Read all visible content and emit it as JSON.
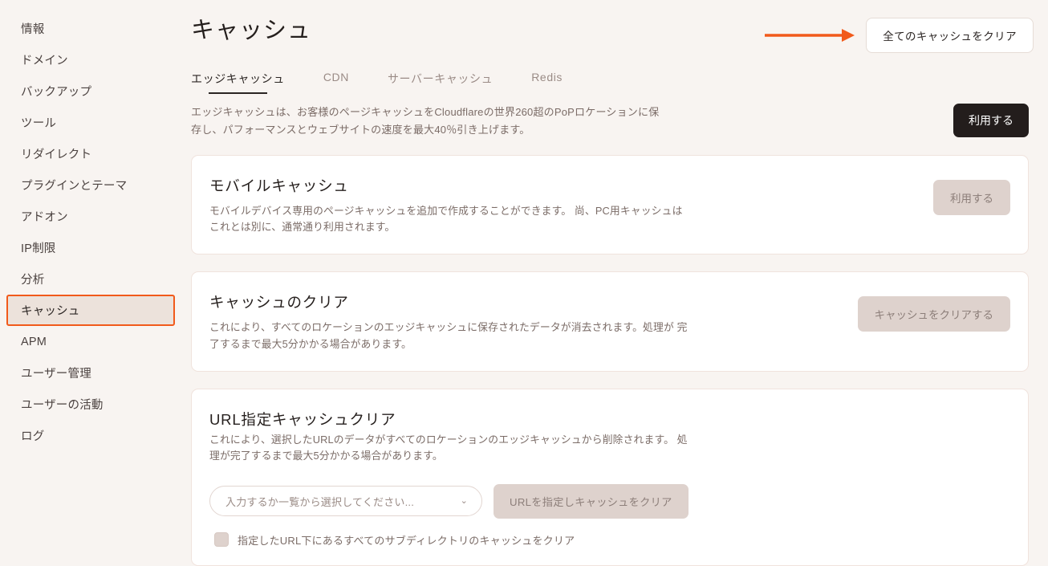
{
  "sidebar": {
    "items": [
      {
        "label": "情報",
        "active": false
      },
      {
        "label": "ドメイン",
        "active": false
      },
      {
        "label": "バックアップ",
        "active": false
      },
      {
        "label": "ツール",
        "active": false
      },
      {
        "label": "リダイレクト",
        "active": false
      },
      {
        "label": "プラグインとテーマ",
        "active": false
      },
      {
        "label": "アドオン",
        "active": false
      },
      {
        "label": "IP制限",
        "active": false
      },
      {
        "label": "分析",
        "active": false
      },
      {
        "label": "キャッシュ",
        "active": true
      },
      {
        "label": "APM",
        "active": false
      },
      {
        "label": "ユーザー管理",
        "active": false
      },
      {
        "label": "ユーザーの活動",
        "active": false
      },
      {
        "label": "ログ",
        "active": false
      }
    ]
  },
  "header": {
    "title": "キャッシュ",
    "clear_all_button": "全てのキャッシュをクリア"
  },
  "tabs": [
    {
      "label": "エッジキャッシュ",
      "active": true
    },
    {
      "label": "CDN",
      "active": false
    },
    {
      "label": "サーバーキャッシュ",
      "active": false
    },
    {
      "label": "Redis",
      "active": false
    }
  ],
  "intro": {
    "text": "エッジキャッシュは、お客様のページキャッシュをCloudflareの世界260超のPoPロケーションに保存し、パフォーマンスとウェブサイトの速度を最大40％引き上げます。",
    "enable_button": "利用する"
  },
  "cards": {
    "mobile_cache": {
      "title": "モバイルキャッシュ",
      "desc": "モバイルデバイス専用のページキャッシュを追加で作成することができます。\n尚、PC用キャッシュはこれとは別に、通常通り利用されます。",
      "button": "利用する"
    },
    "clear_cache": {
      "title": "キャッシュのクリア",
      "desc": "これにより、すべてのロケーションのエッジキャッシュに保存されたデータが消去されます。処理が\n完了するまで最大5分かかる場合があります。",
      "button": "キャッシュをクリアする"
    },
    "url_cache": {
      "title": "URL指定キャッシュクリア",
      "desc": "これにより、選択したURLのデータがすべてのロケーションのエッジキャッシュから削除されます。\n処理が完了するまで最大5分かかる場合があります。",
      "select_placeholder": "入力するか一覧から選択してください...",
      "select_chevron": "⌄",
      "button": "URLを指定しキャッシュをクリア",
      "checkbox_label": "指定したURL下にあるすべてのサブディレクトリのキャッシュをクリア"
    }
  },
  "annotations": {
    "arrow_color": "#f15a1b",
    "highlight_color": "#f15a1b"
  }
}
